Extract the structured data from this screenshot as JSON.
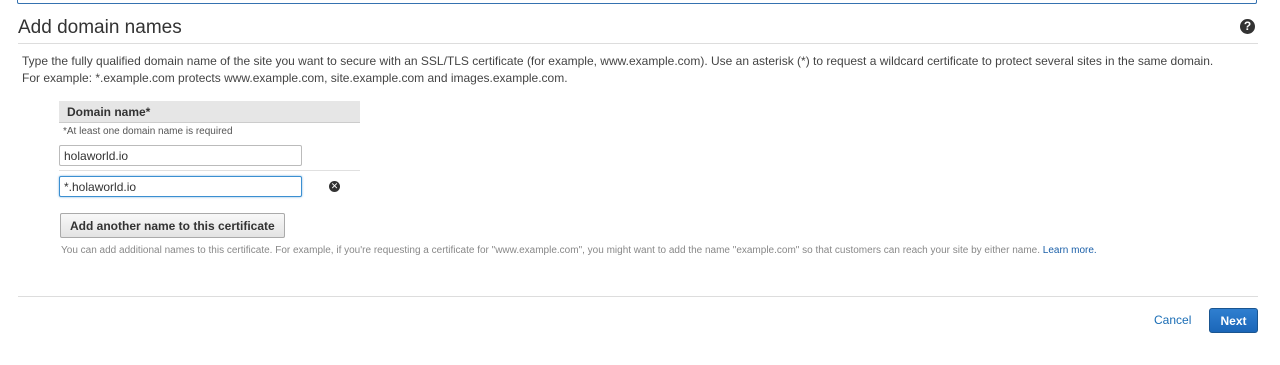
{
  "page": {
    "title": "Add domain names",
    "help_icon": "question-circle-icon",
    "intro": "Type the fully qualified domain name of the site you want to secure with an SSL/TLS certificate (for example, www.example.com). Use an asterisk (*) to request a wildcard certificate to protect several sites in the same domain. For example: *.example.com protects www.example.com, site.example.com and images.example.com."
  },
  "domain_table": {
    "header": "Domain name*",
    "hint": "*At least one domain name is required",
    "rows": [
      {
        "value": "holaworld.io"
      },
      {
        "value": "*.holaworld.io",
        "remove_icon": "remove-circle-icon"
      }
    ]
  },
  "actions": {
    "add_label": "Add another name to this certificate",
    "add_help": "You can add additional names to this certificate. For example, if you're requesting a certificate for \"www.example.com\", you might want to add the name \"example.com\" so that customers can reach your site by either name.",
    "learn_more": "Learn more.",
    "cancel_label": "Cancel",
    "next_label": "Next"
  },
  "colors": {
    "primary": "#1b66b8",
    "link": "#1a6db5",
    "focus": "#3b8fd1"
  }
}
